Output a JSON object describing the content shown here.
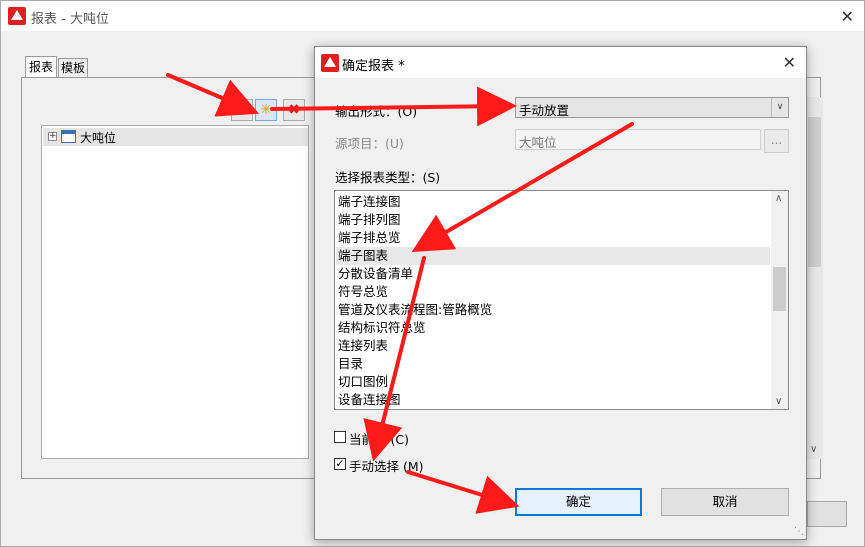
{
  "main_window": {
    "title": "报表 - 大吨位",
    "close_glyph": "✕",
    "tabs": [
      {
        "label": "报表"
      },
      {
        "label": "模板"
      }
    ],
    "toolbar": {
      "add_glyph": "+",
      "new_glyph": "✳",
      "delete_glyph": "✖"
    },
    "tree": {
      "expander_glyph": "+",
      "root_label": "大吨位",
      "root_icon": "table-icon"
    }
  },
  "dialog": {
    "title": "确定报表 *",
    "close_glyph": "✕",
    "output_label": "输出形式：(O)",
    "output_value": "手动放置",
    "source_label": "源项目：(U)",
    "source_value": "大吨位",
    "browse_label": "...",
    "type_label": "选择报表类型：(S)",
    "report_types": [
      "端子连接图",
      "端子排列图",
      "端子排总览",
      "端子图表",
      "分散设备清单",
      "符号总览",
      "管道及仪表流程图:管路概览",
      "结构标识符总览",
      "连接列表",
      "目录",
      "切口图例",
      "设备连接图"
    ],
    "selected_type": "端子图表",
    "current_page_label": "当前页 (C)",
    "current_page_checked": false,
    "manual_select_label": "手动选择 (M)",
    "manual_select_checked": true,
    "ok_label": "确定",
    "cancel_label": "取消"
  },
  "colors": {
    "brand_red": "#e02020",
    "arrow_red": "#ff1a1a",
    "focus_blue": "#0078d7"
  }
}
